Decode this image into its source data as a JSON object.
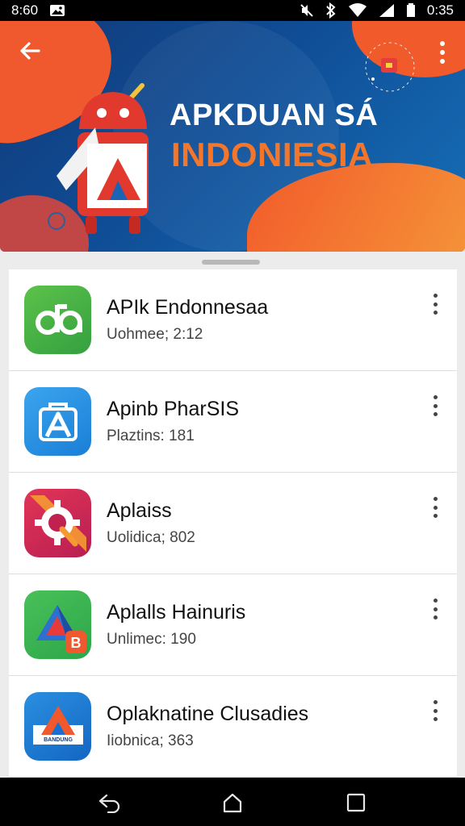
{
  "status_bar": {
    "time_left": "8:60",
    "time_right": "0:35"
  },
  "banner": {
    "title_line1": "APKDUAN SÁ",
    "title_line2": "INDONIESIA",
    "colors": {
      "navy": "#123a78",
      "orange": "#f3762b",
      "accent_red": "#f0582e"
    }
  },
  "apps": [
    {
      "name": "APIk Endonnesaa",
      "meta": "Uohmee; 2:12",
      "icon": "green-da-icon"
    },
    {
      "name": "Apinb PharSIS",
      "meta": "Plaztins: 181",
      "icon": "blue-a-bag-icon"
    },
    {
      "name": "Aplaiss",
      "meta": "Uolidica; 802",
      "icon": "gear-magnifier-icon"
    },
    {
      "name": "Aplalls Hainuris",
      "meta": "Unlimec: 190",
      "icon": "triangle-shop-icon"
    },
    {
      "name": "Oplaknatine Clusadies",
      "meta": "Iiobnica; 363",
      "icon": "blue-a-logo-icon"
    }
  ],
  "app_logo_text": "BANDUNG"
}
